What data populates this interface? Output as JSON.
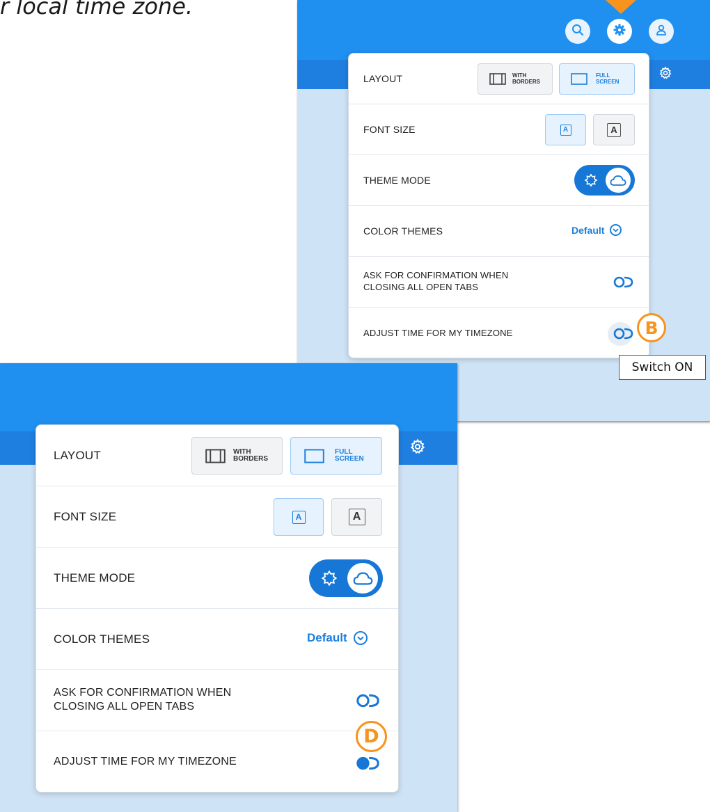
{
  "caption": "r local time zone.",
  "settings": {
    "layout_label": "LAYOUT",
    "layout_with_borders_line1": "WITH",
    "layout_with_borders_line2": "BORDERS",
    "layout_full_line1": "FULL",
    "layout_full_line2": "SCREEN",
    "font_size_label": "FONT SIZE",
    "font_size_glyph": "A",
    "theme_mode_label": "THEME MODE",
    "color_themes_label": "COLOR THEMES",
    "color_themes_value": "Default",
    "confirm_label_line1": "ASK FOR CONFIRMATION WHEN",
    "confirm_label_line2": "CLOSING ALL OPEN TABS",
    "timezone_label": "ADJUST TIME FOR MY TIMEZONE"
  },
  "markers": {
    "b": "B",
    "d": "D"
  },
  "tooltip": "Switch ON",
  "icons": {
    "header": [
      "search-icon",
      "gear-icon",
      "user-icon"
    ],
    "sub_bar": "gear-icon",
    "layout": [
      "borders-layout-icon",
      "fullscreen-layout-icon"
    ],
    "theme": [
      "sun-icon",
      "cloud-icon"
    ],
    "dropdown": "chevron-down-icon",
    "toggle": "toggle-switch-icon"
  },
  "colors": {
    "header_blue": "#1f8ff0",
    "accent_blue": "#1b7fdc",
    "marker_orange": "#f7941d",
    "background_light_blue": "#cfe3f6"
  }
}
